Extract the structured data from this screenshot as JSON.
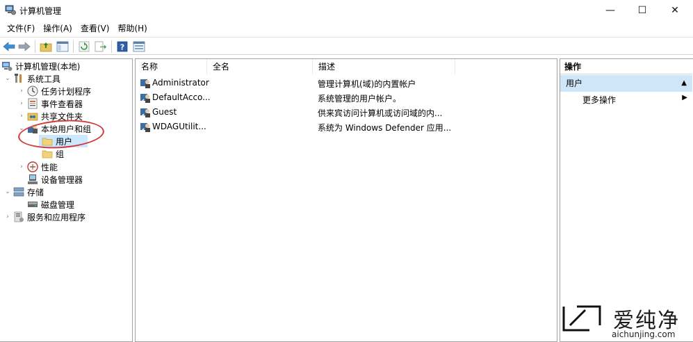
{
  "window": {
    "title": "计算机管理",
    "controls": {
      "minimize": "—",
      "maximize": "☐",
      "close": "✕"
    }
  },
  "menu": [
    "文件(F)",
    "操作(A)",
    "查看(V)",
    "帮助(H)"
  ],
  "toolbar": {
    "icons": [
      "back-arrow-icon",
      "forward-arrow-icon",
      "up-folder-icon",
      "show-hide-tree-icon",
      "refresh-icon",
      "export-icon",
      "help-icon",
      "properties-icon"
    ]
  },
  "tree": {
    "root": "计算机管理(本地)",
    "system_tools": "系统工具",
    "task_scheduler": "任务计划程序",
    "event_viewer": "事件查看器",
    "shared_folders": "共享文件夹",
    "local_users_groups": "本地用户和组",
    "users": "用户",
    "groups": "组",
    "performance": "性能",
    "device_manager": "设备管理器",
    "storage": "存储",
    "disk_management": "磁盘管理",
    "services_apps": "服务和应用程序"
  },
  "list": {
    "columns": [
      "名称",
      "全名",
      "描述"
    ],
    "rows": [
      {
        "name": "Administrator",
        "full_name": "",
        "description": "管理计算机(域)的内置帐户"
      },
      {
        "name": "DefaultAcco...",
        "full_name": "",
        "description": "系统管理的用户帐户。"
      },
      {
        "name": "Guest",
        "full_name": "",
        "description": "供来宾访问计算机或访问域的内..."
      },
      {
        "name": "WDAGUtilit...",
        "full_name": "",
        "description": "系统为 Windows Defender 应用..."
      }
    ]
  },
  "actions": {
    "header": "操作",
    "section": "用户",
    "more": "更多操作"
  },
  "watermark": {
    "brand": "爱纯净",
    "url": "aichunjing.com"
  },
  "colors": {
    "selection": "#cce8ff",
    "action_section": "#cfe6f8",
    "annotation": "#d03a3a"
  }
}
